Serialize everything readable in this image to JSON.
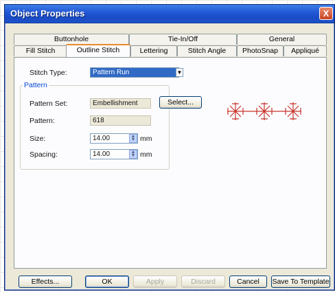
{
  "window": {
    "title": "Object Properties",
    "close_label": "X"
  },
  "tabs_back": [
    {
      "label": "Buttonhole"
    },
    {
      "label": "Tie-In/Off"
    },
    {
      "label": "General"
    }
  ],
  "tabs_front": [
    {
      "label": "Fill Stitch"
    },
    {
      "label": "Outline Stitch",
      "active": true
    },
    {
      "label": "Lettering"
    },
    {
      "label": "Stitch Angle"
    },
    {
      "label": "PhotoSnap"
    },
    {
      "label": "Appliqué"
    }
  ],
  "form": {
    "stitch_type_label": "Stitch Type:",
    "stitch_type_value": "Pattern Run",
    "group_title": "Pattern",
    "pattern_set_label": "Pattern Set:",
    "pattern_set_value": "Embellishment",
    "select_button": "Select...",
    "pattern_label": "Pattern:",
    "pattern_value": "618",
    "size_label": "Size:",
    "size_value": "14.00",
    "size_unit": "mm",
    "spacing_label": "Spacing:",
    "spacing_value": "14.00",
    "spacing_unit": "mm"
  },
  "preview": {
    "color": "#c8322a",
    "icon": "pattern-preview-icon"
  },
  "buttons": {
    "effects": "Effects...",
    "ok": "OK",
    "apply": "Apply",
    "discard": "Discard",
    "cancel": "Cancel",
    "save_template": "Save To Template"
  }
}
